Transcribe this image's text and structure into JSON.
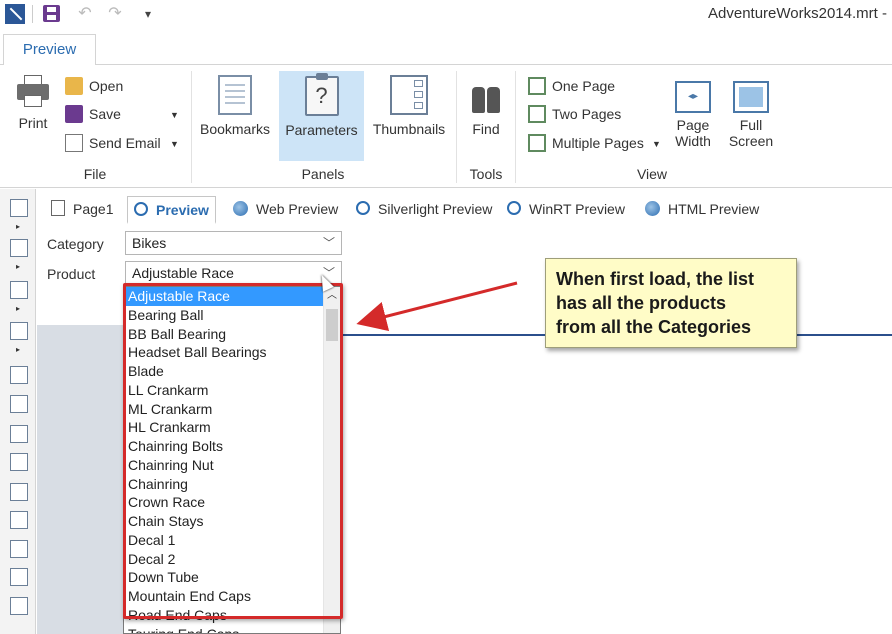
{
  "window": {
    "title": "AdventureWorks2014.mrt -"
  },
  "ribbon": {
    "tab_label": "Preview",
    "groups": {
      "file": {
        "label": "File",
        "print": "Print",
        "open": "Open",
        "save": "Save",
        "send_email": "Send Email"
      },
      "panels": {
        "label": "Panels",
        "bookmarks": "Bookmarks",
        "parameters": "Parameters",
        "thumbnails": "Thumbnails"
      },
      "tools": {
        "label": "Tools",
        "find": "Find"
      },
      "view": {
        "label": "View",
        "one_page": "One Page",
        "two_pages": "Two Pages",
        "multiple_pages": "Multiple Pages",
        "page_width_1": "Page",
        "page_width_2": "Width",
        "full_screen_1": "Full",
        "full_screen_2": "Screen"
      }
    }
  },
  "preview_tabs": [
    "Page1",
    "Preview",
    "Web Preview",
    "Silverlight Preview",
    "WinRT Preview",
    "HTML Preview"
  ],
  "params": {
    "category_label": "Category",
    "category_value": "Bikes",
    "product_label": "Product",
    "product_value": "Adjustable Race"
  },
  "product_list": [
    "Adjustable Race",
    "Bearing Ball",
    "BB Ball Bearing",
    "Headset Ball Bearings",
    "Blade",
    "LL Crankarm",
    "ML Crankarm",
    "HL Crankarm",
    "Chainring Bolts",
    "Chainring Nut",
    "Chainring",
    "Crown Race",
    "Chain Stays",
    "Decal 1",
    "Decal 2",
    "Down Tube",
    "Mountain End Caps",
    "Road End Caps",
    "Touring End Caps"
  ],
  "callout": {
    "line1": "When first load, the list",
    "line2": "has all the products",
    "line3": "from all the Categories"
  },
  "colors": {
    "accent": "#2b6cb0",
    "selection": "#3399ff",
    "annotation_red": "#d42a2a",
    "callout_bg": "#fffcc7"
  }
}
